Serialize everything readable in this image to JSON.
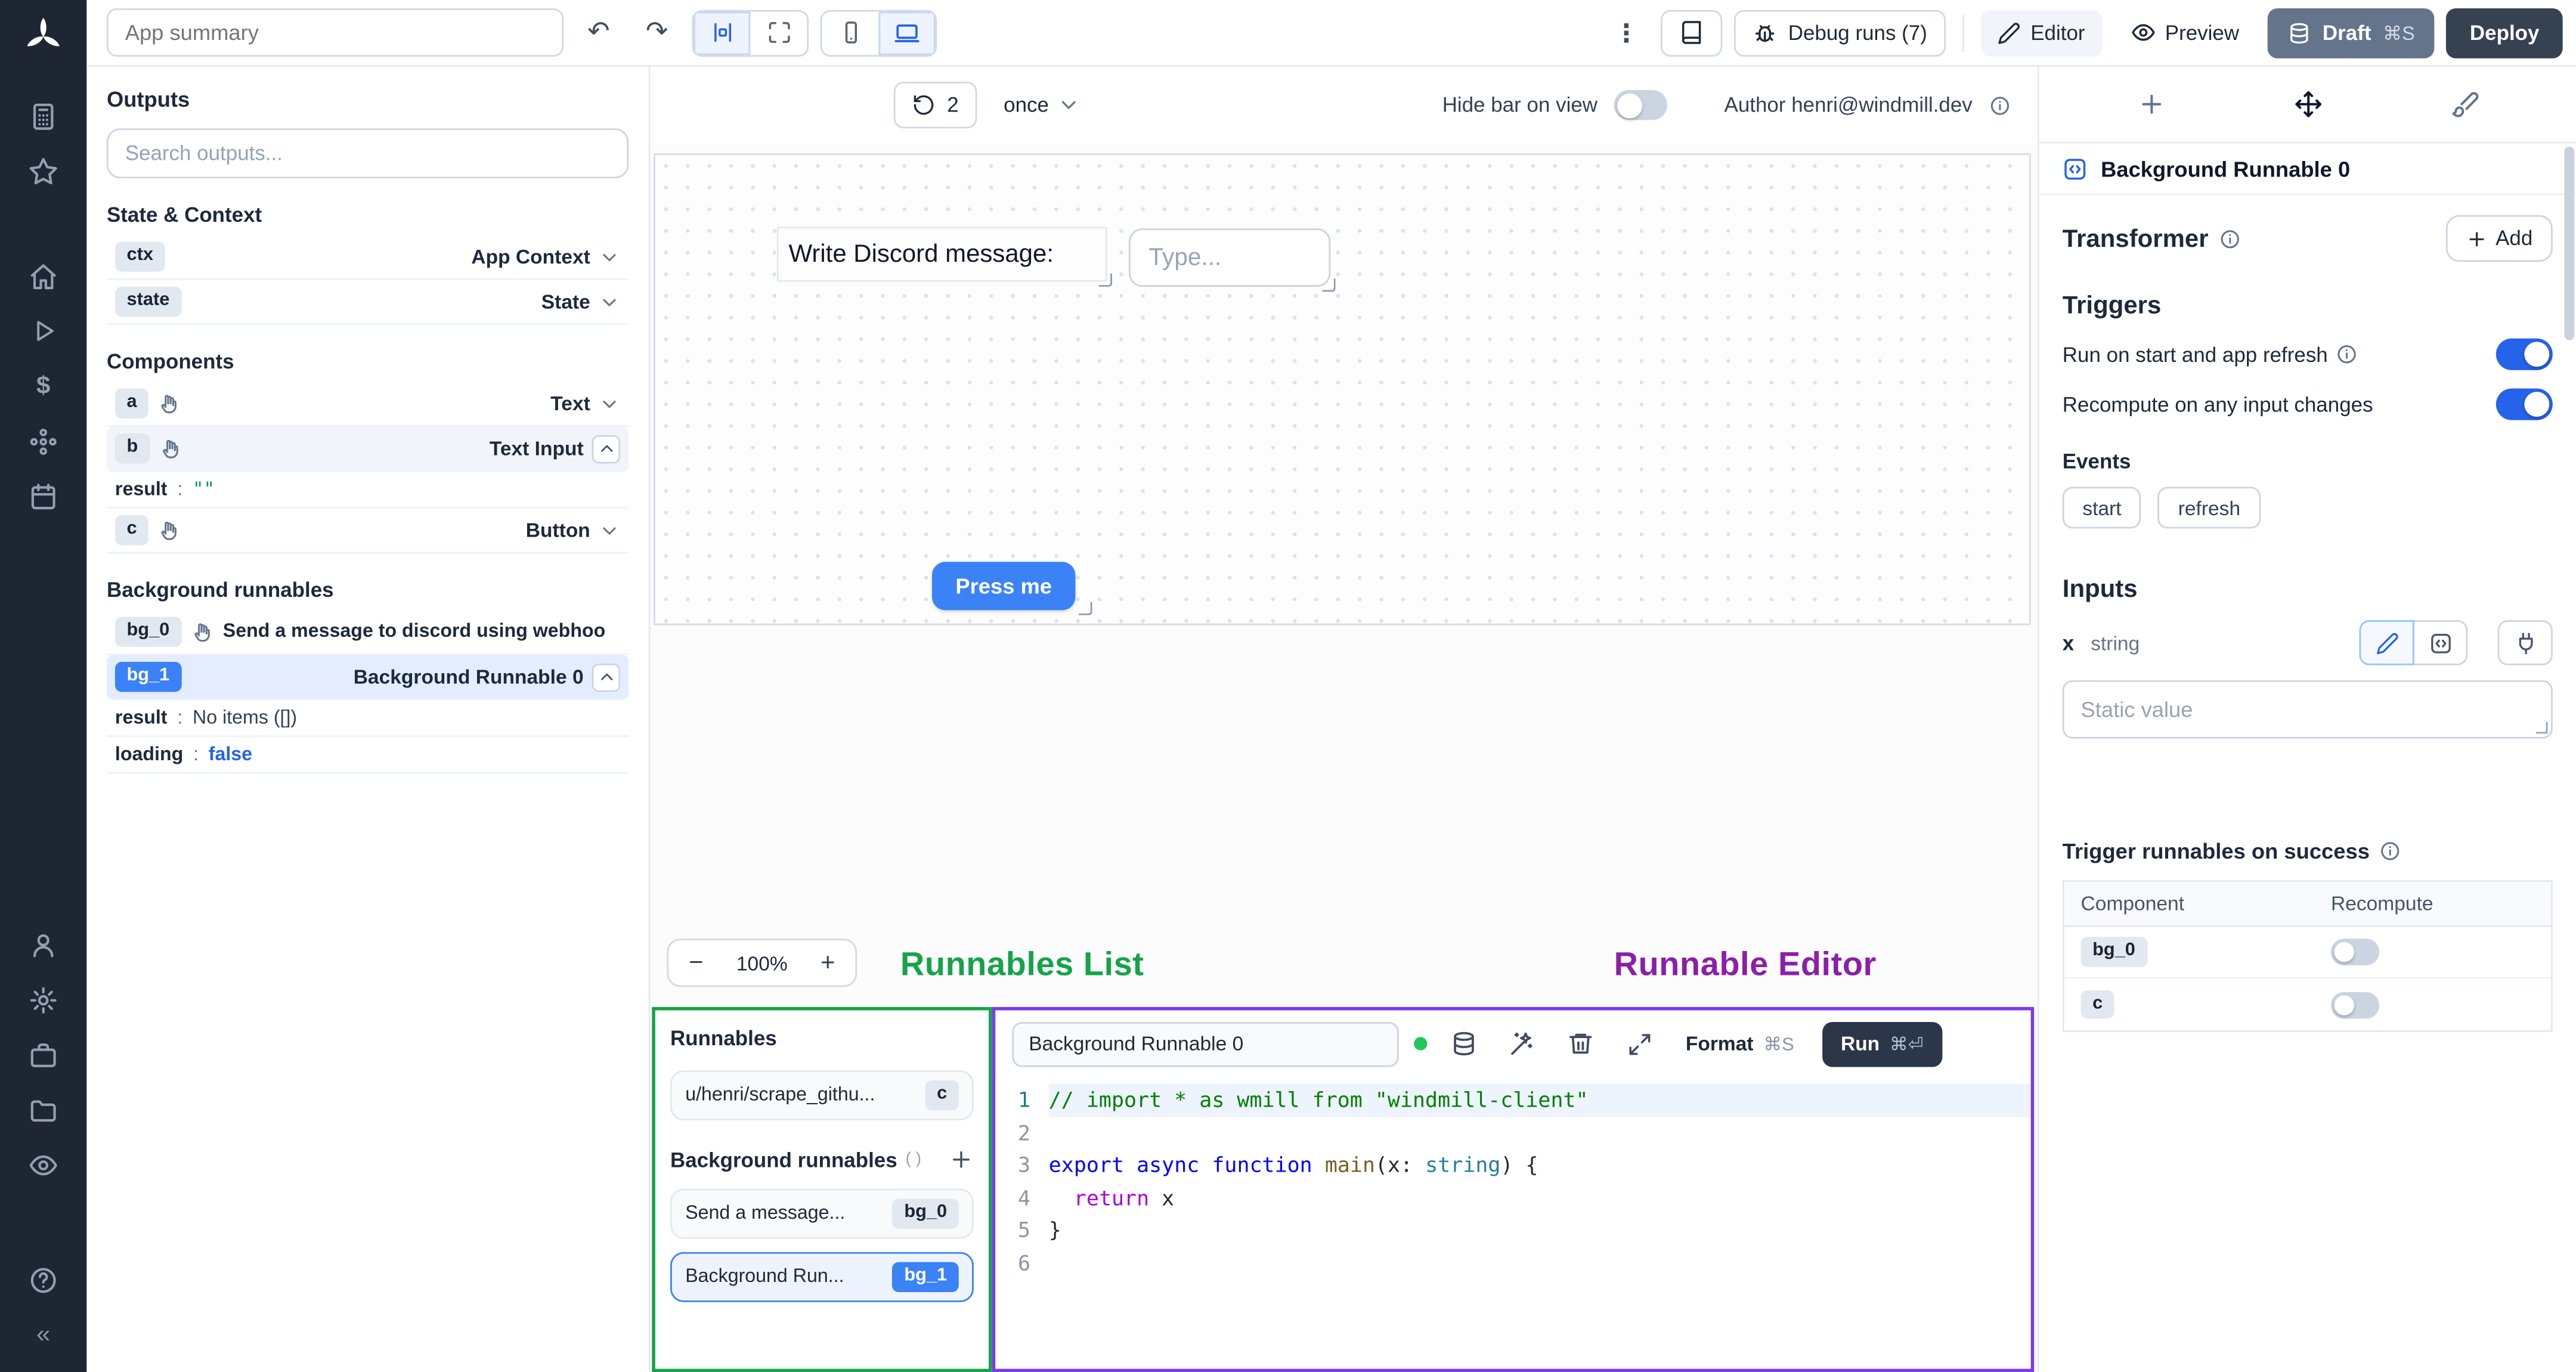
{
  "colors": {
    "accent_blue": "#2563eb",
    "primary_button_blue": "#3b82f6",
    "toggle_on": "#2563eb",
    "overlay_green": "#16a34a",
    "overlay_purple": "#8b1fa8",
    "runnables_panel_border": "#16a34a",
    "editor_panel_border": "#7c3aed",
    "sidebar_bg": "#1e2533",
    "draft_button": "#64748b",
    "deploy_button": "#364152",
    "code_comment_green": "#008000",
    "status_dot_green": "#22c55e"
  },
  "icons": {
    "windmill-logo": "white pinwheel",
    "apps-icon": "keypad",
    "favorites-star-icon": "star",
    "home-icon": "house",
    "runs-icon": "play-triangle",
    "variables-icon": "$",
    "resources-icon": "hub-dots",
    "schedules-icon": "calendar",
    "user-icon": "person",
    "settings-icon": "gear",
    "workspace-icon": "briefcase",
    "folders-icon": "folder",
    "audit-icon": "eye",
    "help-icon": "question-circle",
    "collapse-sidebar-icon": "«",
    "undo-icon": "↶",
    "redo-icon": "↷",
    "align-center-icon": "|□|",
    "fullscreen-icon": "corner-arrows",
    "mobile-icon": "smartphone",
    "desktop-icon": "laptop",
    "kebab-menu-icon": "⋮",
    "docs-icon": "book",
    "debug-icon": "bug",
    "editor-icon": "pencil",
    "preview-icon": "eye",
    "refresh-icon": "rotate-ccw",
    "chevron-down-icon": "⌄",
    "chevron-up-icon": "⌃",
    "info-icon": "ⓘ",
    "hand-pointer-icon": "hand",
    "plus-icon": "+",
    "cache-icon": "database",
    "ai-wand-icon": "wand-sparkles",
    "delete-icon": "trash",
    "expand-icon": "maximize",
    "function-icon": "code-square",
    "connect-icon": "plug",
    "components-tab-icon": "move-arrows",
    "styling-tab-icon": "paintbrush",
    "resize-handle-icon": "corner"
  },
  "topbar": {
    "app_summary_placeholder": "App summary",
    "debug_runs_label": "Debug runs (7)",
    "editor_label": "Editor",
    "preview_label": "Preview",
    "draft_label": "Draft",
    "draft_shortcut": "⌘S",
    "deploy_label": "Deploy"
  },
  "outputs": {
    "title": "Outputs",
    "search_placeholder": "Search outputs...",
    "state_context_header": "State & Context",
    "ctx_badge": "ctx",
    "ctx_label": "App Context",
    "state_badge": "state",
    "state_label": "State",
    "components_header": "Components",
    "a_badge": "a",
    "a_label": "Text",
    "b_badge": "b",
    "b_label": "Text Input",
    "b_result_key": "result",
    "b_result_colon": ":",
    "b_result_value": "\"\"",
    "c_badge": "c",
    "c_label": "Button",
    "background_header": "Background runnables",
    "bg0_badge": "bg_0",
    "bg0_label": "Send a message to discord using webhoo",
    "bg1_badge": "bg_1",
    "bg1_label": "Background Runnable 0",
    "bg1_result_key": "result",
    "bg1_result_colon": ":",
    "bg1_result_value": "No items ([])",
    "bg1_loading_key": "loading",
    "bg1_loading_colon": ":",
    "bg1_loading_value": "false"
  },
  "canvas": {
    "refresh_count": "2",
    "schedule_mode": "once",
    "hide_bar_label": "Hide bar on view",
    "author_label": "Author henri@windmill.dev",
    "text_component": "Write Discord message:",
    "input_placeholder": "Type...",
    "button_label": "Press me",
    "zoom_out": "−",
    "zoom_level": "100%",
    "zoom_in": "+"
  },
  "overlay": {
    "runnables_list": "Runnables List",
    "runnable_editor": "Runnable Editor"
  },
  "runnables": {
    "title": "Runnables",
    "script_label": "u/henri/scrape_githu...",
    "script_badge": "c",
    "background_header": "Background runnables",
    "bg0_label": "Send a message...",
    "bg0_badge": "bg_0",
    "bg1_label": "Background Run...",
    "bg1_badge": "bg_1"
  },
  "editor": {
    "name_value": "Background Runnable 0",
    "format_label": "Format",
    "format_shortcut": "⌘S",
    "run_label": "Run",
    "run_shortcut": "⌘⏎",
    "code": {
      "lines": [
        [
          {
            "t": "// import * as wmill from \"windmill-client\"",
            "c": "comment"
          }
        ],
        [],
        [
          {
            "t": "export",
            "c": "kw"
          },
          {
            "t": " ",
            "c": "p"
          },
          {
            "t": "async",
            "c": "kw"
          },
          {
            "t": " ",
            "c": "p"
          },
          {
            "t": "function",
            "c": "kw"
          },
          {
            "t": " ",
            "c": "p"
          },
          {
            "t": "main",
            "c": "fn"
          },
          {
            "t": "(x: ",
            "c": "p"
          },
          {
            "t": "string",
            "c": "type"
          },
          {
            "t": ") {",
            "c": "p"
          }
        ],
        [
          {
            "t": "  ",
            "c": "p"
          },
          {
            "t": "return",
            "c": "ctrl"
          },
          {
            "t": " x",
            "c": "p"
          }
        ],
        [
          {
            "t": "}",
            "c": "p"
          }
        ],
        []
      ]
    }
  },
  "inspector": {
    "runnable_title": "Background Runnable 0",
    "transformer_label": "Transformer",
    "add_label": "Add",
    "triggers_title": "Triggers",
    "run_on_start_label": "Run on start and app refresh",
    "recompute_label": "Recompute on any input changes",
    "events_label": "Events",
    "event_start": "start",
    "event_refresh": "refresh",
    "inputs_title": "Inputs",
    "input_name": "x",
    "input_type": "string",
    "static_value_placeholder": "Static value",
    "trigger_success_label": "Trigger runnables on success",
    "table": {
      "component_header": "Component",
      "recompute_header": "Recompute",
      "rows": [
        {
          "badge": "bg_0",
          "recompute_on": false
        },
        {
          "badge": "c",
          "recompute_on": false
        }
      ]
    }
  }
}
